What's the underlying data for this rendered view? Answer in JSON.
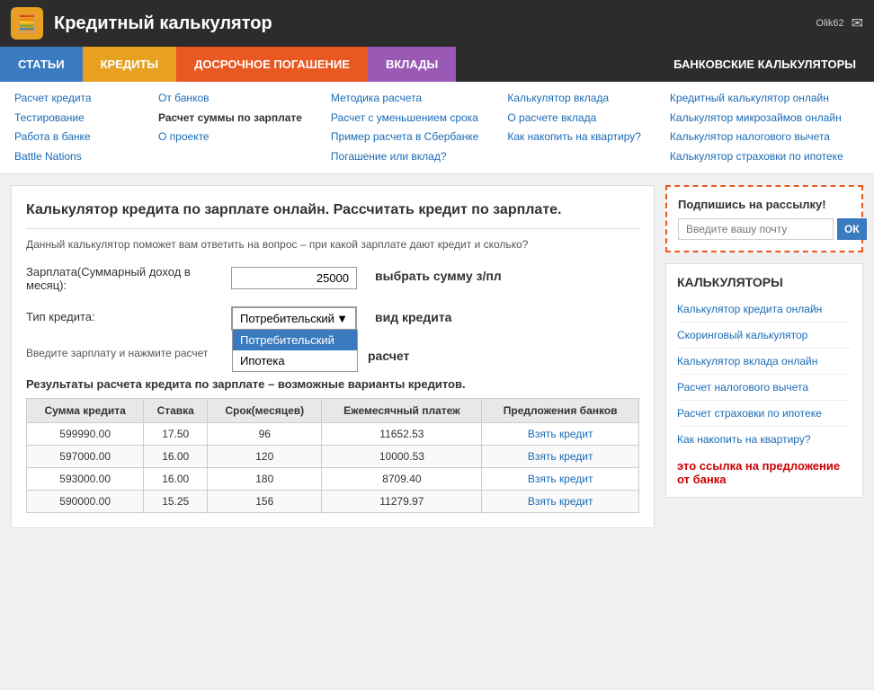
{
  "header": {
    "title": "Кредитный калькулятор",
    "icon": "🧮",
    "user": "Olik62",
    "envelope": "✉"
  },
  "nav": {
    "items": [
      {
        "label": "СТАТЬИ"
      },
      {
        "label": "КРЕДИТЫ"
      },
      {
        "label": "ДОСРОЧНОЕ ПОГАШЕНИЕ"
      },
      {
        "label": "ВКЛАДЫ"
      },
      {
        "label": "БАНКОВСКИЕ КАЛЬКУЛЯТОРЫ"
      }
    ]
  },
  "subnav": {
    "col1": [
      {
        "text": "Расчет кредита",
        "bold": false
      },
      {
        "text": "Тестирование",
        "bold": false
      },
      {
        "text": "Работа в банке",
        "bold": false
      },
      {
        "text": "Battle Nations",
        "bold": false
      }
    ],
    "col2": [
      {
        "text": "От банков",
        "bold": false
      },
      {
        "text": "Расчет суммы по зарплате",
        "bold": true
      },
      {
        "text": "О проекте",
        "bold": false
      }
    ],
    "col3": [
      {
        "text": "Методика расчета",
        "bold": false
      },
      {
        "text": "Расчет с уменьшением срока",
        "bold": false
      },
      {
        "text": "Пример расчета в Сбербанке",
        "bold": false
      },
      {
        "text": "Погашение или вклад?",
        "bold": false
      }
    ],
    "col4": [
      {
        "text": "Калькулятор вклада",
        "bold": false
      },
      {
        "text": "О расчете вклада",
        "bold": false
      },
      {
        "text": "Как накопить на квартиру?",
        "bold": false
      }
    ],
    "col5": [
      {
        "text": "Кредитный калькулятор онлайн",
        "bold": false
      },
      {
        "text": "Калькулятор микрозаймов онлайн",
        "bold": false
      },
      {
        "text": "Калькулятор налогового вычета",
        "bold": false
      },
      {
        "text": "Калькулятор страховки по ипотеке",
        "bold": false
      }
    ]
  },
  "main": {
    "calc_title": "Калькулятор кредита по зарплате онлайн. Рассчитать кредит по зарплате.",
    "calc_desc": "Данный калькулятор поможет вам ответить на вопрос – при какой зарплате дают кредит и сколько?",
    "salary_label": "Зарплата(Суммарный доход в месяц):",
    "salary_value": "25000",
    "credit_type_label": "Тип кредита:",
    "credit_type_value": "Потребительский",
    "credit_type_options": [
      "Потребительский",
      "Ипотека"
    ],
    "note_label": "Введите зарплату и нажмите расчет",
    "side_salary": "выбрать сумму з/пл",
    "side_type": "вид кредита",
    "side_note": "расчет",
    "results_title": "Результаты расчета кредита по зарплате – возможные варианты кредитов.",
    "table": {
      "headers": [
        "Сумма кредита",
        "Ставка",
        "Срок(месяцев)",
        "Ежемесячный платеж",
        "Предложения банков"
      ],
      "rows": [
        {
          "sum": "599990.00",
          "rate": "17.50",
          "term": "96",
          "payment": "11652.53",
          "link": "Взять кредит"
        },
        {
          "sum": "597000.00",
          "rate": "16.00",
          "term": "120",
          "payment": "10000.53",
          "link": "Взять кредит"
        },
        {
          "sum": "593000.00",
          "rate": "16.00",
          "term": "180",
          "payment": "8709.40",
          "link": "Взять кредит"
        },
        {
          "sum": "590000.00",
          "rate": "15.25",
          "term": "156",
          "payment": "11279.97",
          "link": "Взять кредит"
        }
      ]
    }
  },
  "sidebar": {
    "newsletter_title": "Подпишись на рассылку!",
    "newsletter_placeholder": "Введите вашу почту",
    "newsletter_btn": "ОК",
    "calculators_title": "КАЛЬКУЛЯТОРЫ",
    "calc_links": [
      "Калькулятор кредита онлайн",
      "Скоринговый калькулятор",
      "Калькулятор вклада онлайн",
      "Расчет налогового вычета",
      "Расчет страховки по ипотеке",
      "Как накопить на квартиру?"
    ],
    "red_note": "это ссылка на предложение от банка"
  }
}
